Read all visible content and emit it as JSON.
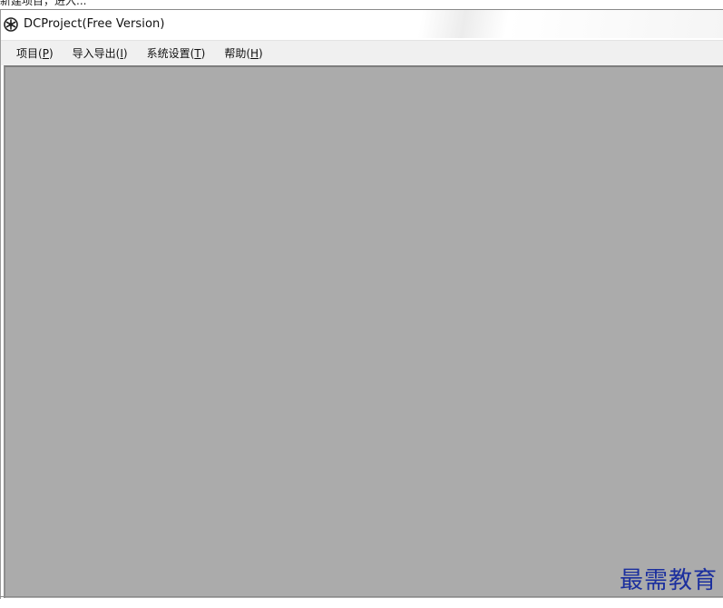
{
  "top_strip": {
    "text": "新建项目，进入..."
  },
  "window": {
    "title": "DCProject(Free Version)",
    "icon": "app-logo-icon"
  },
  "menubar": {
    "items": [
      {
        "label": "项目",
        "accel": "P"
      },
      {
        "label": "导入导出",
        "accel": "I"
      },
      {
        "label": "系统设置",
        "accel": "T"
      },
      {
        "label": "帮助",
        "accel": "H"
      }
    ]
  },
  "watermark": {
    "text": "最需教育"
  },
  "colors": {
    "client_background": "#ababab",
    "menubar_background": "#f0f0f0",
    "watermark": "#1b2f9e"
  }
}
